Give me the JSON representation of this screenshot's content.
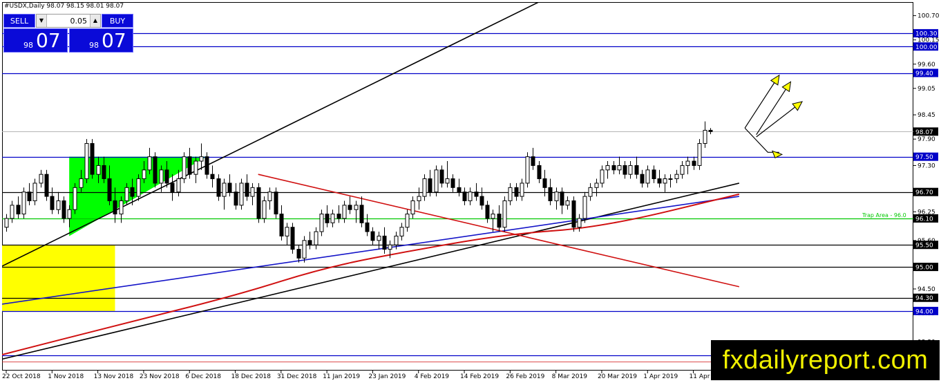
{
  "header": {
    "title": "#USDX,Daily  98.07 98.15 98.01 98.07"
  },
  "trade_panel": {
    "sell_label": "SELL",
    "buy_label": "BUY",
    "lot_value": "0.05",
    "sell_quote_small": "98",
    "sell_quote_big": "07",
    "buy_quote_small": "98",
    "buy_quote_big": "07",
    "button_color": "#0a0ad8"
  },
  "watermark": {
    "text": "fxdailyreport.com",
    "text_color": "#f0f000",
    "bg_color": "#000000"
  },
  "chart_data": {
    "type": "candlestick",
    "symbol": "#USDX",
    "timeframe": "Daily",
    "ohlc_label": "98.07 98.15 98.01 98.07",
    "y_range": [
      92.5,
      101.0
    ],
    "x_range": [
      0,
      125
    ],
    "y_ticks": [
      {
        "value": 100.7,
        "label": "100.70"
      },
      {
        "value": 100.15,
        "label": "100.15"
      },
      {
        "value": 99.6,
        "label": "99.60"
      },
      {
        "value": 99.05,
        "label": "99.05"
      },
      {
        "value": 98.45,
        "label": "98.45"
      },
      {
        "value": 97.9,
        "label": "97.90"
      },
      {
        "value": 97.3,
        "label": "97.30"
      },
      {
        "value": 96.25,
        "label": "96.25"
      },
      {
        "value": 95.6,
        "label": "95.60"
      },
      {
        "value": 94.5,
        "label": "94.50"
      },
      {
        "value": 93.95,
        "label": "93.95"
      },
      {
        "value": 93.3,
        "label": "93.30"
      },
      {
        "value": 92.8,
        "label": "92.80"
      }
    ],
    "x_labels": [
      {
        "index": 0,
        "label": "22 Oct 2018"
      },
      {
        "index": 8,
        "label": "1 Nov 2018"
      },
      {
        "index": 16,
        "label": "13 Nov 2018"
      },
      {
        "index": 24,
        "label": "23 Nov 2018"
      },
      {
        "index": 32,
        "label": "6 Dec 2018"
      },
      {
        "index": 40,
        "label": "18 Dec 2018"
      },
      {
        "index": 48,
        "label": "31 Dec 2018"
      },
      {
        "index": 56,
        "label": "11 Jan 2019"
      },
      {
        "index": 64,
        "label": "23 Jan 2019"
      },
      {
        "index": 72,
        "label": "4 Feb 2019"
      },
      {
        "index": 80,
        "label": "14 Feb 2019"
      },
      {
        "index": 88,
        "label": "26 Feb 2019"
      },
      {
        "index": 96,
        "label": "8 Mar 2019"
      },
      {
        "index": 104,
        "label": "20 Mar 2019"
      },
      {
        "index": 112,
        "label": "1 Apr 2019"
      },
      {
        "index": 120,
        "label": "11 Apr 2019"
      }
    ],
    "price_levels": [
      {
        "value": 100.3,
        "label": "100.30",
        "color": "#0000c8",
        "tag_color": "#0000c8"
      },
      {
        "value": 100.0,
        "label": "100.00",
        "color": "#0000c8",
        "tag_color": "#0000c8"
      },
      {
        "value": 99.4,
        "label": "99.40",
        "color": "#0000c8",
        "tag_color": "#0000c8"
      },
      {
        "value": 97.5,
        "label": "97.50",
        "color": "#0000c8",
        "tag_color": "#0000c8"
      },
      {
        "value": 96.7,
        "label": "96.70",
        "color": "#000000",
        "tag_color": "#000000"
      },
      {
        "value": 96.1,
        "label": "96.10",
        "color": "#00c800",
        "tag_color": "#000000"
      },
      {
        "value": 95.5,
        "label": "95.50",
        "color": "#000000",
        "tag_color": "#000000"
      },
      {
        "value": 95.0,
        "label": "95.00",
        "color": "#000000",
        "tag_color": "#000000"
      },
      {
        "value": 94.3,
        "label": "94.30",
        "color": "#000000",
        "tag_color": "#000000"
      },
      {
        "value": 94.0,
        "label": "94.00",
        "color": "#0000c8",
        "tag_color": "#0000c8"
      },
      {
        "value": 93.0,
        "label": "93.00",
        "color": "#0000c8",
        "tag_color": "#0000c8"
      }
    ],
    "current_price": {
      "value": 98.07,
      "label": "98.07"
    },
    "trap_area_label": {
      "text": "Trap Area - 96.0",
      "color": "#00c800",
      "value": 96.1
    },
    "candles": [
      [
        95.9,
        96.2,
        95.8,
        96.1
      ],
      [
        96.1,
        96.5,
        96.0,
        96.4
      ],
      [
        96.4,
        96.6,
        96.1,
        96.2
      ],
      [
        96.2,
        96.8,
        96.1,
        96.7
      ],
      [
        96.7,
        96.9,
        96.4,
        96.5
      ],
      [
        96.5,
        97.0,
        96.4,
        96.9
      ],
      [
        96.9,
        97.2,
        96.8,
        97.1
      ],
      [
        97.1,
        97.2,
        96.5,
        96.6
      ],
      [
        96.6,
        96.8,
        96.2,
        96.3
      ],
      [
        96.3,
        96.7,
        96.2,
        96.5
      ],
      [
        96.5,
        96.6,
        96.0,
        96.1
      ],
      [
        96.1,
        96.4,
        95.9,
        96.3
      ],
      [
        96.3,
        96.9,
        96.2,
        96.8
      ],
      [
        96.8,
        97.2,
        96.7,
        97.0
      ],
      [
        97.0,
        97.9,
        96.9,
        97.8
      ],
      [
        97.8,
        97.9,
        97.0,
        97.1
      ],
      [
        97.1,
        97.5,
        96.9,
        97.3
      ],
      [
        97.3,
        97.5,
        96.9,
        97.0
      ],
      [
        97.0,
        97.3,
        96.4,
        96.5
      ],
      [
        96.5,
        96.8,
        96.0,
        96.2
      ],
      [
        96.2,
        96.6,
        96.0,
        96.5
      ],
      [
        96.5,
        96.9,
        96.4,
        96.8
      ],
      [
        96.8,
        97.0,
        96.4,
        96.6
      ],
      [
        96.6,
        97.1,
        96.5,
        97.0
      ],
      [
        97.0,
        97.4,
        96.9,
        97.2
      ],
      [
        97.2,
        97.7,
        97.1,
        97.5
      ],
      [
        97.5,
        97.6,
        96.8,
        96.9
      ],
      [
        96.9,
        97.3,
        96.7,
        97.2
      ],
      [
        97.2,
        97.4,
        96.8,
        96.9
      ],
      [
        96.9,
        97.1,
        96.5,
        96.7
      ],
      [
        96.7,
        97.2,
        96.6,
        97.0
      ],
      [
        97.0,
        97.6,
        96.9,
        97.5
      ],
      [
        97.5,
        97.7,
        97.0,
        97.1
      ],
      [
        97.1,
        97.5,
        96.9,
        97.4
      ],
      [
        97.4,
        97.8,
        97.2,
        97.5
      ],
      [
        97.5,
        97.6,
        97.0,
        97.1
      ],
      [
        97.1,
        97.3,
        96.8,
        97.0
      ],
      [
        97.0,
        97.1,
        96.5,
        96.6
      ],
      [
        96.6,
        97.0,
        96.3,
        96.9
      ],
      [
        96.9,
        97.1,
        96.6,
        96.7
      ],
      [
        96.7,
        96.9,
        96.3,
        96.4
      ],
      [
        96.4,
        97.0,
        96.3,
        96.9
      ],
      [
        96.9,
        97.1,
        96.5,
        96.6
      ],
      [
        96.6,
        96.9,
        96.4,
        96.8
      ],
      [
        96.8,
        96.9,
        96.0,
        96.1
      ],
      [
        96.1,
        96.6,
        96.0,
        96.5
      ],
      [
        96.5,
        96.8,
        96.3,
        96.7
      ],
      [
        96.7,
        96.8,
        96.1,
        96.2
      ],
      [
        96.2,
        96.4,
        95.6,
        95.7
      ],
      [
        95.7,
        96.0,
        95.5,
        95.9
      ],
      [
        95.9,
        96.0,
        95.3,
        95.4
      ],
      [
        95.4,
        95.5,
        95.1,
        95.2
      ],
      [
        95.2,
        95.7,
        95.1,
        95.6
      ],
      [
        95.6,
        95.8,
        95.4,
        95.5
      ],
      [
        95.5,
        95.9,
        95.4,
        95.8
      ],
      [
        95.8,
        96.3,
        95.7,
        96.2
      ],
      [
        96.2,
        96.4,
        95.9,
        96.0
      ],
      [
        96.0,
        96.3,
        95.9,
        96.2
      ],
      [
        96.2,
        96.4,
        96.0,
        96.1
      ],
      [
        96.1,
        96.5,
        96.0,
        96.4
      ],
      [
        96.4,
        96.6,
        96.2,
        96.3
      ],
      [
        96.3,
        96.5,
        96.0,
        96.4
      ],
      [
        96.4,
        96.6,
        95.9,
        96.0
      ],
      [
        96.0,
        96.2,
        95.7,
        95.8
      ],
      [
        95.8,
        95.9,
        95.5,
        95.6
      ],
      [
        95.6,
        95.8,
        95.4,
        95.7
      ],
      [
        95.7,
        95.9,
        95.3,
        95.4
      ],
      [
        95.4,
        95.6,
        95.2,
        95.5
      ],
      [
        95.5,
        95.8,
        95.4,
        95.7
      ],
      [
        95.7,
        96.0,
        95.6,
        95.9
      ],
      [
        95.9,
        96.3,
        95.8,
        96.2
      ],
      [
        96.2,
        96.6,
        96.1,
        96.5
      ],
      [
        96.5,
        96.8,
        96.3,
        96.6
      ],
      [
        96.6,
        97.1,
        96.5,
        97.0
      ],
      [
        97.0,
        97.2,
        96.6,
        96.7
      ],
      [
        96.7,
        97.3,
        96.6,
        97.2
      ],
      [
        97.2,
        97.3,
        96.8,
        96.9
      ],
      [
        96.9,
        97.4,
        96.8,
        97.0
      ],
      [
        97.0,
        97.1,
        96.7,
        96.8
      ],
      [
        96.8,
        97.0,
        96.6,
        96.7
      ],
      [
        96.7,
        96.8,
        96.4,
        96.5
      ],
      [
        96.5,
        96.8,
        96.4,
        96.7
      ],
      [
        96.7,
        96.9,
        96.5,
        96.6
      ],
      [
        96.6,
        96.8,
        96.3,
        96.4
      ],
      [
        96.4,
        96.5,
        96.0,
        96.1
      ],
      [
        96.1,
        96.3,
        95.8,
        96.2
      ],
      [
        96.2,
        96.4,
        95.8,
        95.9
      ],
      [
        95.9,
        96.6,
        95.8,
        96.5
      ],
      [
        96.5,
        96.9,
        96.4,
        96.8
      ],
      [
        96.8,
        96.9,
        96.5,
        96.6
      ],
      [
        96.6,
        97.0,
        96.5,
        96.9
      ],
      [
        96.9,
        97.6,
        96.8,
        97.5
      ],
      [
        97.5,
        97.7,
        97.2,
        97.3
      ],
      [
        97.3,
        97.4,
        96.9,
        97.0
      ],
      [
        97.0,
        97.2,
        96.6,
        96.8
      ],
      [
        96.8,
        97.0,
        96.4,
        96.5
      ],
      [
        96.5,
        96.8,
        96.3,
        96.7
      ],
      [
        96.7,
        96.8,
        96.2,
        96.4
      ],
      [
        96.4,
        96.6,
        96.3,
        96.5
      ],
      [
        96.5,
        96.6,
        95.8,
        95.9
      ],
      [
        95.9,
        96.2,
        95.8,
        96.1
      ],
      [
        96.1,
        96.7,
        96.0,
        96.6
      ],
      [
        96.6,
        96.9,
        96.5,
        96.8
      ],
      [
        96.8,
        97.0,
        96.6,
        96.9
      ],
      [
        96.9,
        97.3,
        96.8,
        97.2
      ],
      [
        97.2,
        97.4,
        97.0,
        97.3
      ],
      [
        97.3,
        97.4,
        97.1,
        97.2
      ],
      [
        97.2,
        97.5,
        97.1,
        97.3
      ],
      [
        97.3,
        97.4,
        97.0,
        97.1
      ],
      [
        97.1,
        97.4,
        97.0,
        97.3
      ],
      [
        97.3,
        97.5,
        97.0,
        97.1
      ],
      [
        97.1,
        97.2,
        96.8,
        96.9
      ],
      [
        96.9,
        97.3,
        96.8,
        97.2
      ],
      [
        97.2,
        97.3,
        96.9,
        97.0
      ],
      [
        97.0,
        97.2,
        96.8,
        96.9
      ],
      [
        96.9,
        97.1,
        96.7,
        97.0
      ],
      [
        97.0,
        97.1,
        96.8,
        97.0
      ],
      [
        97.0,
        97.2,
        96.9,
        97.1
      ],
      [
        97.1,
        97.4,
        97.0,
        97.3
      ],
      [
        97.3,
        97.5,
        97.1,
        97.4
      ],
      [
        97.4,
        97.5,
        97.2,
        97.3
      ],
      [
        97.3,
        97.9,
        97.2,
        97.8
      ],
      [
        97.8,
        98.3,
        97.7,
        98.1
      ],
      [
        98.1,
        98.15,
        98.01,
        98.07
      ]
    ],
    "trendlines": [
      {
        "color": "#000000",
        "points": [
          [
            -1,
            95.0
          ],
          [
            96,
            101.2
          ]
        ]
      },
      {
        "color": "#000000",
        "points": [
          [
            -1,
            92.9
          ],
          [
            128,
            96.9
          ]
        ]
      },
      {
        "color": "#1414c8",
        "points": [
          [
            -1,
            94.15
          ],
          [
            128,
            96.6
          ]
        ]
      },
      {
        "color": "#d01010",
        "points": [
          [
            44,
            97.1
          ],
          [
            128,
            94.55
          ]
        ]
      },
      {
        "color": "#d01010",
        "points": [
          [
            -1,
            93.0
          ],
          [
            20,
            93.7
          ],
          [
            40,
            94.35
          ],
          [
            56,
            95.0
          ],
          [
            72,
            95.4
          ],
          [
            88,
            95.75
          ],
          [
            104,
            95.9
          ],
          [
            128,
            96.65
          ]
        ],
        "smooth": true
      }
    ],
    "zones": [
      {
        "color": "#00ff00",
        "polygon": [
          [
            11,
            97.5
          ],
          [
            35,
            97.5
          ],
          [
            11,
            95.7
          ]
        ]
      },
      {
        "color": "#ffff00",
        "rect": {
          "x0": -1,
          "x1": 19,
          "y0": 94.0,
          "y1": 95.5
        }
      }
    ],
    "arrows": [
      {
        "from": [
          129,
          98.15
        ],
        "to": [
          135,
          99.35
        ],
        "color": "#ffff00"
      },
      {
        "from": [
          131,
          98.0
        ],
        "to": [
          137,
          99.2
        ],
        "color": "#ffff00"
      },
      {
        "from": [
          131,
          97.95
        ],
        "to": [
          139,
          98.75
        ],
        "color": "#ffff00"
      }
    ],
    "arrow_head_brackets": [
      {
        "points": [
          [
            129,
            98.15
          ],
          [
            133,
            97.6
          ],
          [
            135,
            97.6
          ]
        ]
      }
    ],
    "grid": false,
    "bull_color": "#ffffff",
    "bear_color": "#000000"
  }
}
